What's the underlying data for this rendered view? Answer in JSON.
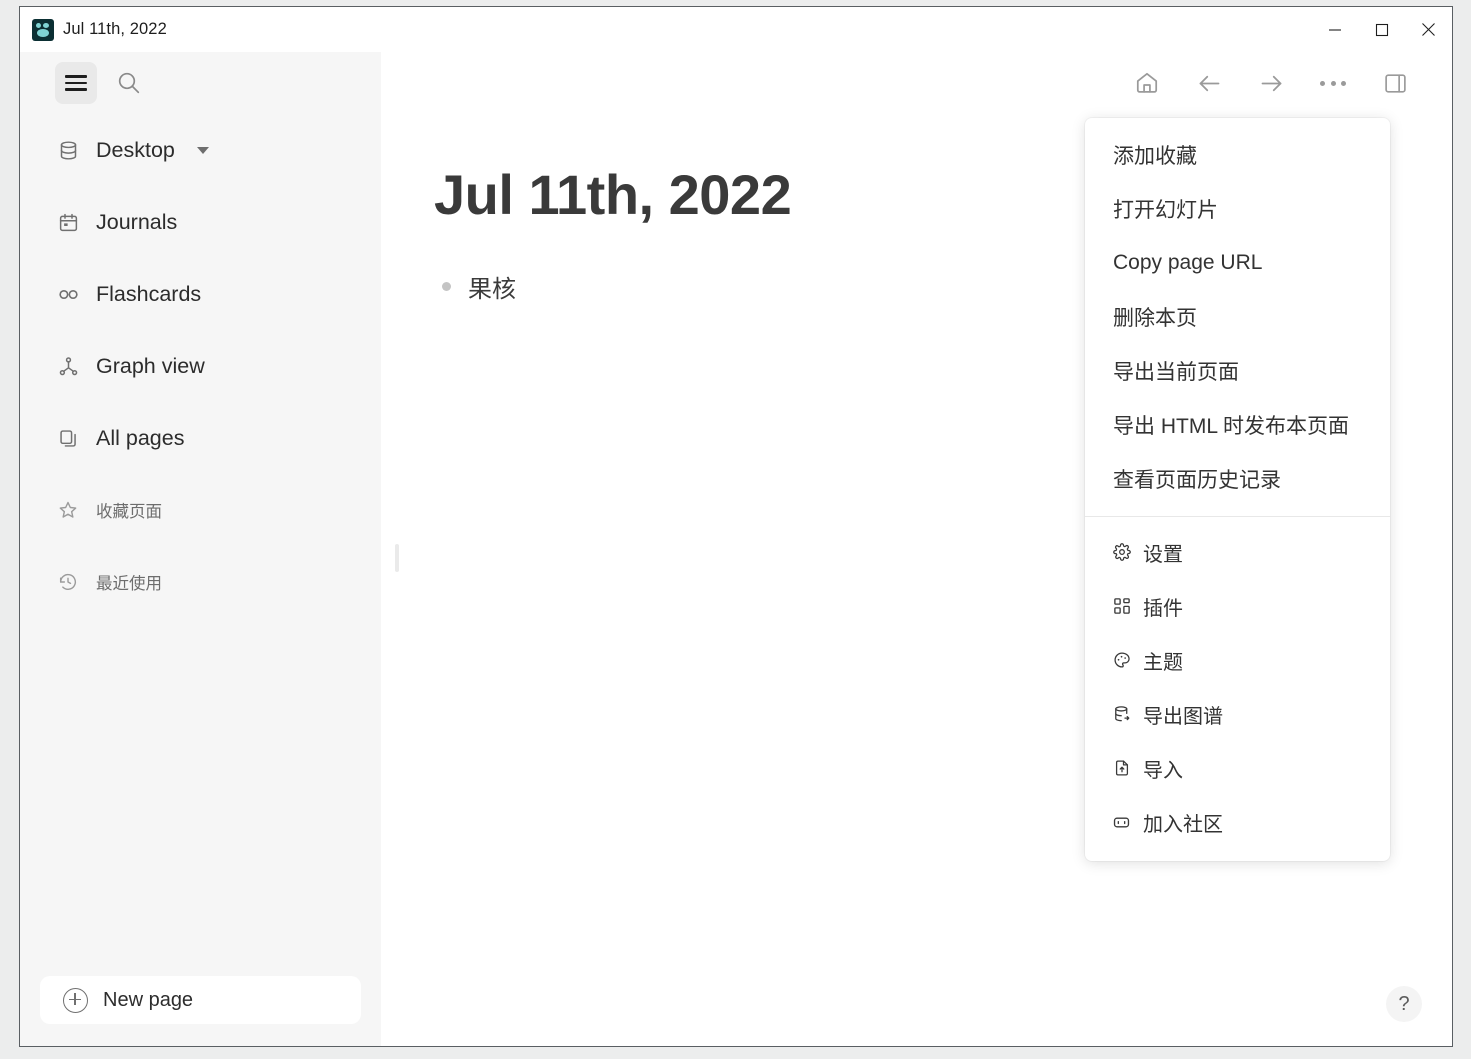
{
  "window": {
    "title": "Jul 11th, 2022",
    "app_icon": "logseq-logo-icon",
    "controls": {
      "minimize": "minimize-button",
      "maximize": "maximize-button",
      "close": "close-button"
    }
  },
  "sidebar": {
    "hamburger_label": "menu-toggle",
    "search_label": "search",
    "items": [
      {
        "label": "Desktop",
        "icon": "database-icon",
        "has_caret": true,
        "muted": false
      },
      {
        "label": "Journals",
        "icon": "calendar-icon",
        "has_caret": false,
        "muted": false
      },
      {
        "label": "Flashcards",
        "icon": "infinity-icon",
        "has_caret": false,
        "muted": false
      },
      {
        "label": "Graph view",
        "icon": "graph-icon",
        "has_caret": false,
        "muted": false
      },
      {
        "label": "All pages",
        "icon": "pages-icon",
        "has_caret": false,
        "muted": false
      },
      {
        "label": "收藏页面",
        "icon": "star-icon",
        "has_caret": false,
        "muted": true
      },
      {
        "label": "最近使用",
        "icon": "history-icon",
        "has_caret": false,
        "muted": true
      }
    ],
    "new_page_label": "New page"
  },
  "toolbar": {
    "home": "home-icon",
    "back": "arrow-left-icon",
    "forward": "arrow-right-icon",
    "more": "more-horizontal-icon",
    "right_sidebar": "right-sidebar-toggle-icon"
  },
  "page": {
    "title": "Jul 11th, 2022",
    "blocks": [
      {
        "text": "果核"
      }
    ]
  },
  "help": {
    "label": "?"
  },
  "dropdown": {
    "group_one": [
      {
        "label": "添加收藏"
      },
      {
        "label": "打开幻灯片"
      },
      {
        "label": "Copy page URL"
      },
      {
        "label": "删除本页"
      },
      {
        "label": "导出当前页面"
      },
      {
        "label": "导出 HTML 时发布本页面"
      },
      {
        "label": "查看页面历史记录"
      }
    ],
    "group_two": [
      {
        "label": "设置",
        "icon": "gear-icon"
      },
      {
        "label": "插件",
        "icon": "puzzle-grid-icon"
      },
      {
        "label": "主题",
        "icon": "palette-icon"
      },
      {
        "label": "导出图谱",
        "icon": "database-export-icon"
      },
      {
        "label": "导入",
        "icon": "file-import-icon"
      },
      {
        "label": "加入社区",
        "icon": "discord-icon"
      }
    ]
  },
  "colors": {
    "sidebar_bg": "#f6f6f6",
    "main_bg": "#ffffff",
    "title_text": "#3a3a3a",
    "muted_text": "#6d6d6d",
    "icon": "#707070",
    "accent_logo": "#7fd4d4"
  }
}
